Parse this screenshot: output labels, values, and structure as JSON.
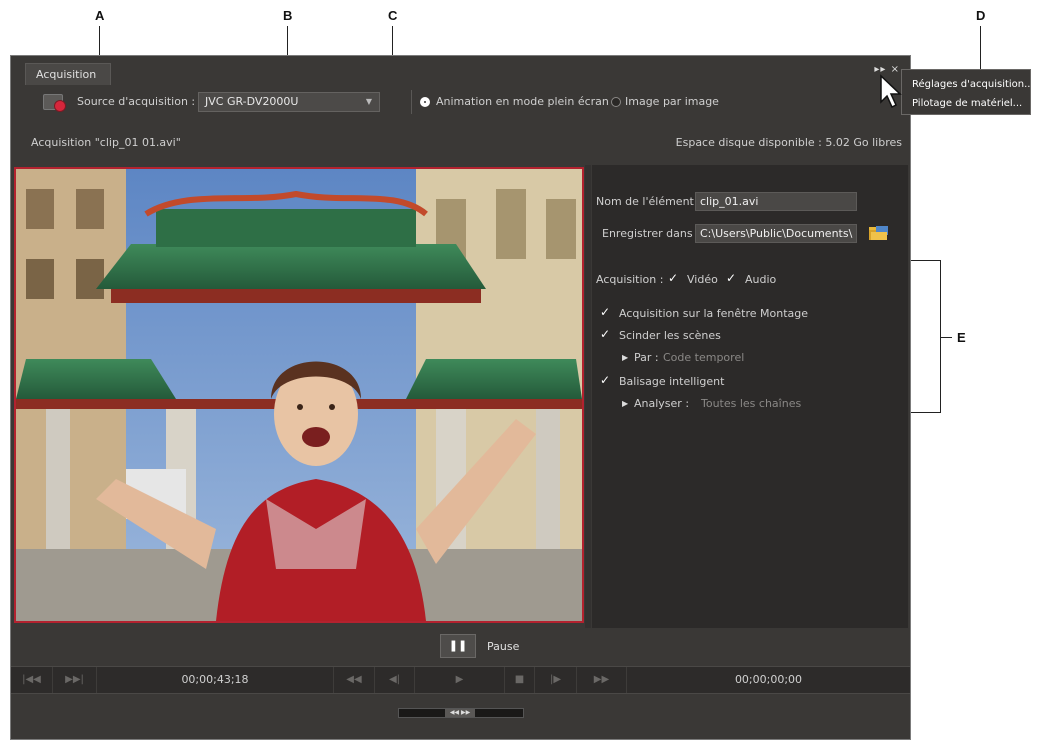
{
  "callouts": {
    "a": "A",
    "b": "B",
    "c": "C",
    "d": "D",
    "e": "E"
  },
  "window": {
    "tab_label": "Acquisition",
    "controls": "▸▸ ×"
  },
  "toolbar": {
    "source_label": "Source d'acquisition :",
    "source_value": "JVC GR-DV2000U",
    "mode_fullscreen": "Animation en mode plein écran",
    "mode_frame": "Image par image",
    "mode_selected": "fullscreen"
  },
  "status": {
    "capture_text": "Acquisition \"clip_01 01.avi\"",
    "disk_space": "Espace disque disponible : 5.02 Go libres"
  },
  "settings": {
    "clip_name_label": "Nom de l'élément :",
    "clip_name_value": "clip_01.avi",
    "save_in_label": "Enregistrer dans :",
    "save_in_value": "C:\\Users\\Public\\Documents\\",
    "capture_label": "Acquisition :",
    "video_label": "Vidéo",
    "audio_label": "Audio",
    "timeline_label": "Acquisition sur la fenêtre Montage",
    "split_label": "Scinder les scènes",
    "by_label": "Par :",
    "by_value": "Code temporel",
    "smart_label": "Balisage intelligent",
    "analyze_label": "Analyser :",
    "analyze_value": "Toutes les chaînes",
    "checks": {
      "video": true,
      "audio": true,
      "timeline": true,
      "split": true,
      "smart": true
    }
  },
  "transport": {
    "pause_label": "Pause",
    "timecode_current": "00;00;43;18",
    "timecode_end": "00;00;00;00"
  },
  "menu": {
    "items": [
      "Réglages d'acquisition...",
      "Pilotage de matériel..."
    ]
  },
  "colors": {
    "record_red": "#d6263b",
    "preview_border": "#b3222f",
    "panel_bg": "#3a3836"
  }
}
